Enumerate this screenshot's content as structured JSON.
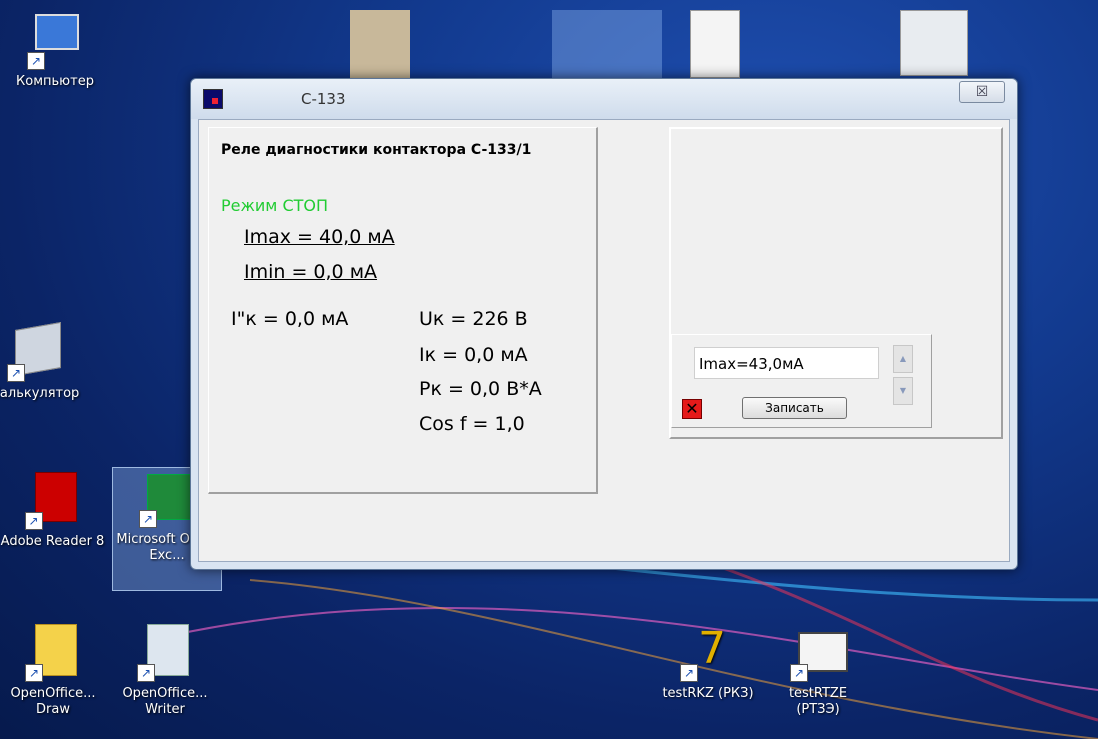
{
  "desktop": {
    "icons": [
      {
        "label": "Компьютер"
      },
      {
        "label": "Калькулятор"
      },
      {
        "label": "Adobe Reader 8"
      },
      {
        "label": "Microsoft Office Exc..."
      },
      {
        "label": "OpenOffice... Draw"
      },
      {
        "label": "OpenOffice... Writer"
      },
      {
        "label": "testRKZ (РКЗ)"
      },
      {
        "label": "testRTZE (РТЗЭ)"
      }
    ]
  },
  "window": {
    "title": "C-133",
    "close_glyph": "☒"
  },
  "left_panel": {
    "relay_title": "Реле диагностики контактора C-133/1",
    "mode": "Режим СТОП",
    "imax": "Imax = 40,0 мА",
    "imin": "Imin = 0,0 мА",
    "ik2": "I\"к = 0,0 мА",
    "uk": "Uк = 226 В",
    "ik": "Iк  = 0,0 мА",
    "pk": "Pк = 0,0 В*А",
    "cos": "Cos f = 1,0"
  },
  "right_panel": {
    "imax_field": "Imax=43,0мА",
    "spin_up": "▲",
    "spin_down": "▼",
    "x_glyph": "✕",
    "write_button": "Записать"
  },
  "colors": {
    "mode_color": "#22cc33",
    "desktop_bg": "#0b2466"
  }
}
